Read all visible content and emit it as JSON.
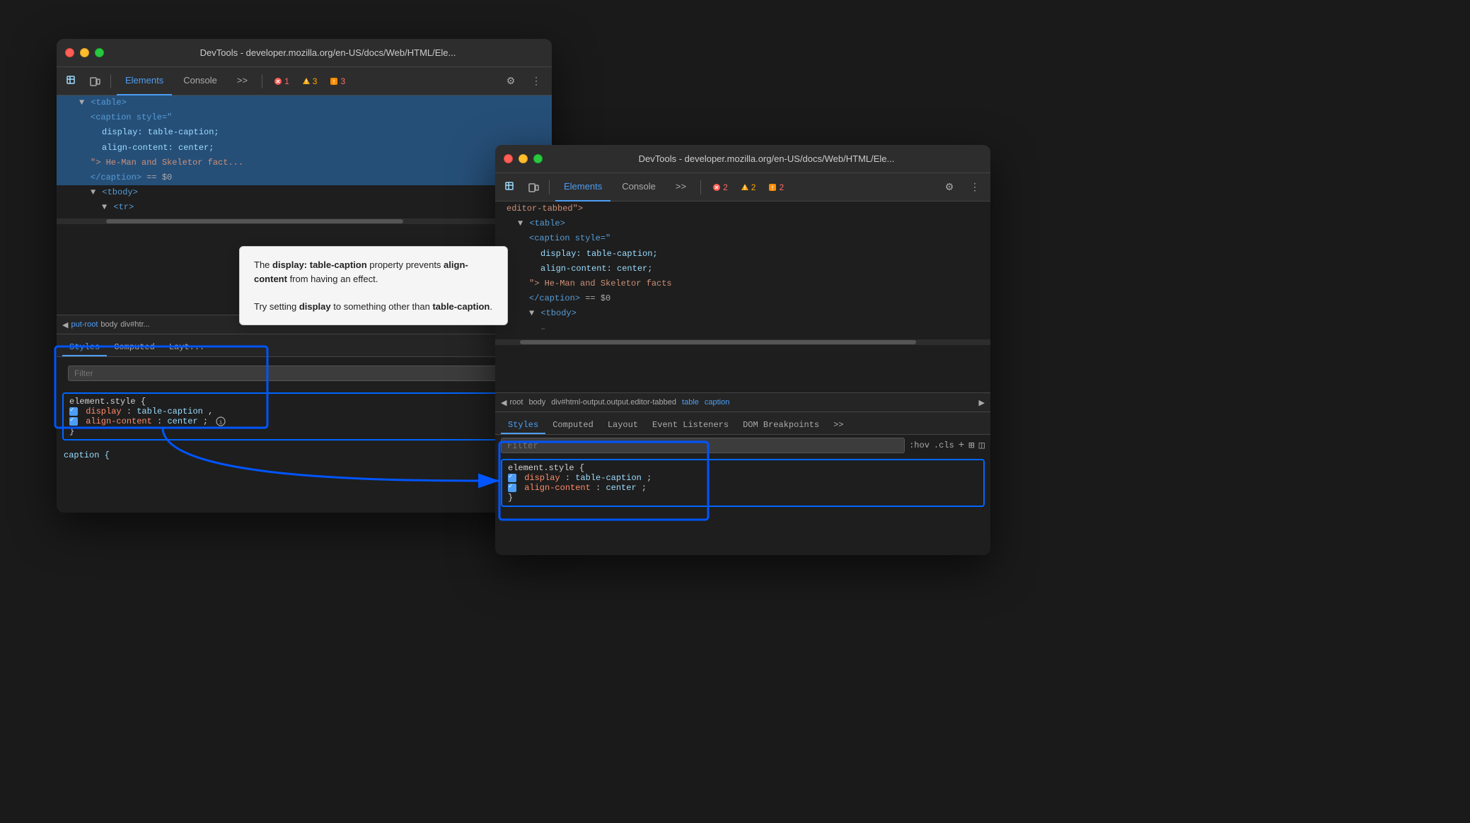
{
  "window1": {
    "title": "DevTools - developer.mozilla.org/en-US/docs/Web/HTML/Ele...",
    "tabs": {
      "elements": "Elements",
      "console": "Console",
      "more": ">>"
    },
    "badges": {
      "error": "1",
      "warn": "3",
      "info": "3"
    },
    "html_lines": [
      {
        "text": "▼ <table>",
        "indent": 0,
        "selected": true
      },
      {
        "text": "<caption style=\"",
        "indent": 1,
        "selected": true
      },
      {
        "text": "display: table-caption;",
        "indent": 2,
        "selected": true
      },
      {
        "text": "align-content: center;",
        "indent": 2,
        "selected": true
      },
      {
        "text": "\"> He-Man and Skeletor fact...",
        "indent": 1,
        "selected": true
      },
      {
        "text": "</caption> == $0",
        "indent": 1,
        "selected": true
      },
      {
        "text": "▼ <tbody>",
        "indent": 1
      },
      {
        "text": "▼ <tr>",
        "indent": 2
      }
    ],
    "breadcrumb": {
      "items": [
        "◀",
        "put-root",
        "body",
        "div#htr..."
      ]
    },
    "styles": {
      "tabs": [
        "Styles",
        "Computed",
        "Layt..."
      ],
      "filter_placeholder": "Filter",
      "rule": {
        "selector": "element.style {",
        "props": [
          {
            "name": "display",
            "value": "table-caption,"
          },
          {
            "name": "align-content",
            "value": "center;"
          }
        ],
        "close": "}"
      },
      "caption_rule": "caption {"
    },
    "tooltip": {
      "text_before": "The ",
      "bold1": "display: table-caption",
      "text_mid1": " property\nprevents ",
      "bold2": "align-content",
      "text_mid2": " from having an\neffect.",
      "text_before2": "\nTry setting ",
      "bold3": "display",
      "text_mid3": " to something other than\n",
      "bold4": "table-caption",
      "text_end": "."
    }
  },
  "window2": {
    "title": "DevTools - developer.mozilla.org/en-US/docs/Web/HTML/Ele...",
    "tabs": {
      "elements": "Elements",
      "console": "Console",
      "more": ">>"
    },
    "badges": {
      "error": "2",
      "warn": "2",
      "info": "2"
    },
    "html_lines": [
      {
        "text": "editor-tabbed\">",
        "indent": 0
      },
      {
        "text": "▼ <table>",
        "indent": 0
      },
      {
        "text": "<caption style=\"",
        "indent": 1
      },
      {
        "text": "display: table-caption;",
        "indent": 2
      },
      {
        "text": "align-content: center;",
        "indent": 2
      },
      {
        "text": "\"> He-Man and Skeletor facts",
        "indent": 1
      },
      {
        "text": "</caption> == $0",
        "indent": 1
      },
      {
        "text": "▼ <tbody>",
        "indent": 1
      },
      {
        "text": "–",
        "indent": 2
      }
    ],
    "breadcrumb": {
      "items": [
        "◀",
        "root",
        "body",
        "div#html-output.output.editor-tabbed",
        "table",
        "caption"
      ]
    },
    "styles": {
      "tabs": [
        "Styles",
        "Computed",
        "Layout",
        "Event Listeners",
        "DOM Breakpoints",
        ">>"
      ],
      "filter_placeholder": "Filter",
      "filter_actions": [
        ":hov",
        ".cls",
        "+",
        "⊞",
        "◫"
      ],
      "rule": {
        "selector": "element.style {",
        "props": [
          {
            "name": "display",
            "value": "table-caption;"
          },
          {
            "name": "align-content",
            "value": "center;"
          }
        ],
        "close": "}"
      }
    }
  },
  "arrow": {
    "start": "left panel highlighted box",
    "end": "right panel highlighted box"
  },
  "icons": {
    "inspect": "⬚",
    "device": "⬒",
    "gear": "⚙",
    "more": "⋮",
    "back": "◀"
  }
}
